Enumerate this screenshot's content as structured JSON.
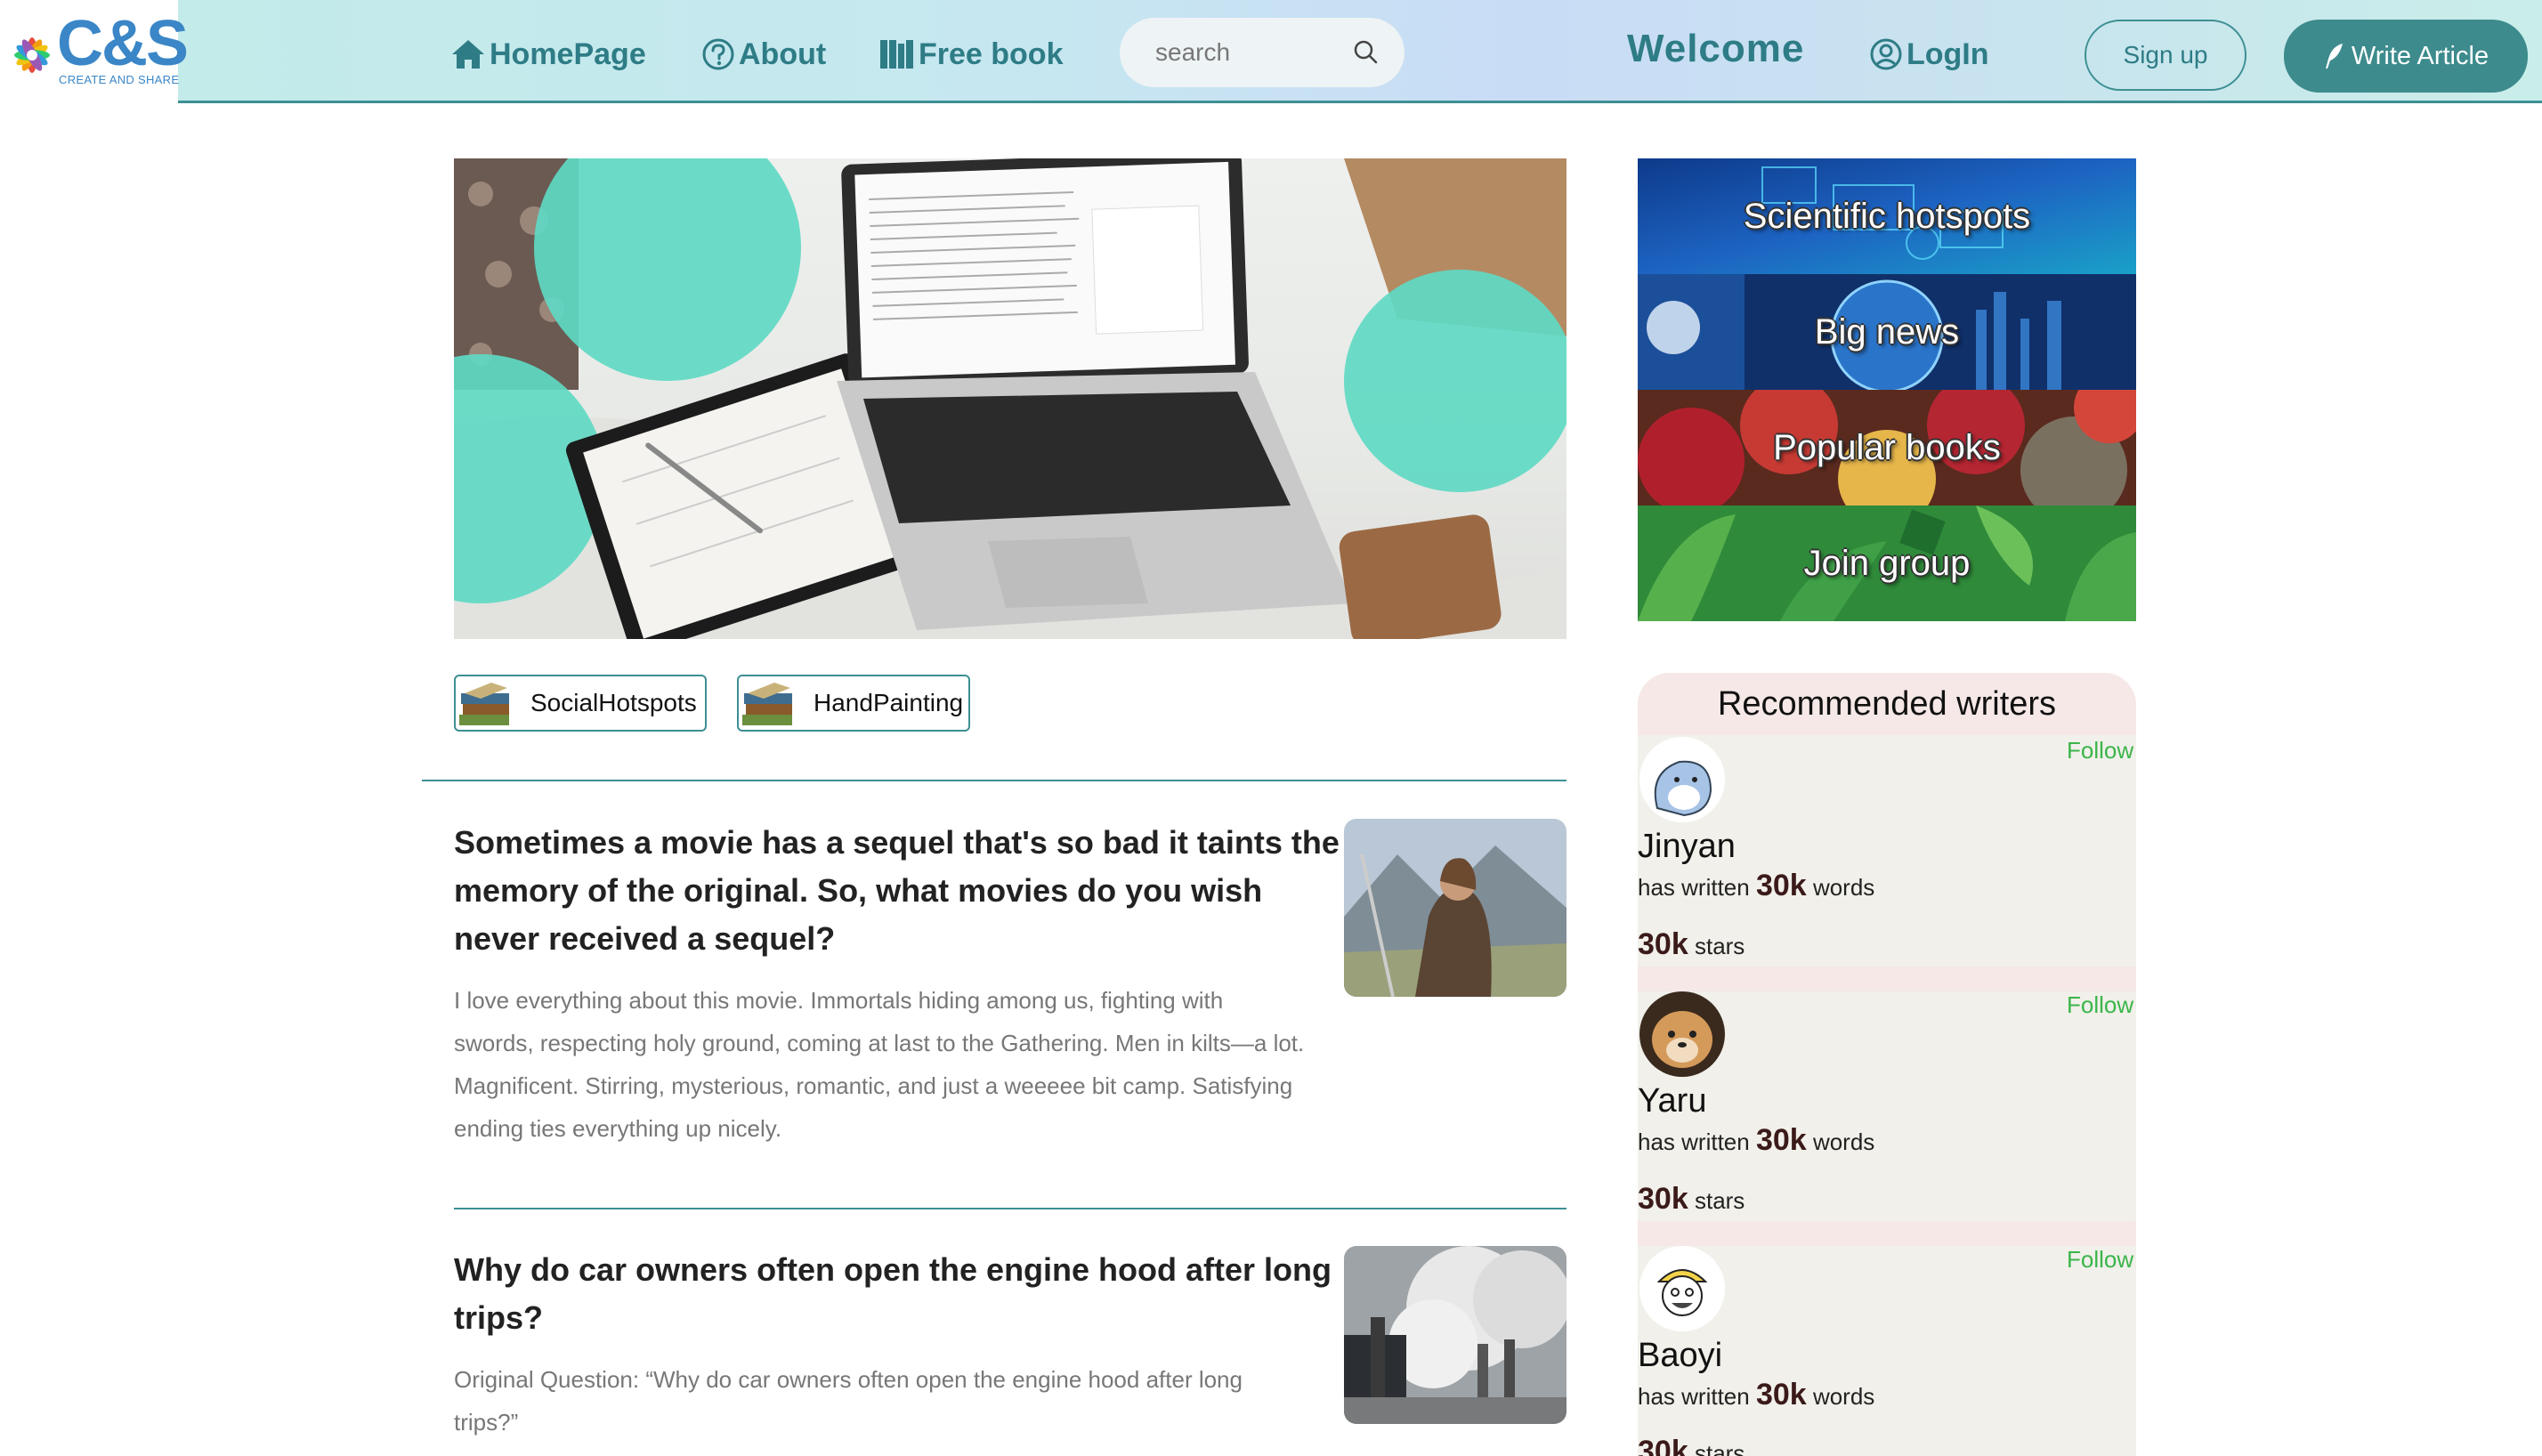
{
  "logo": {
    "text": "C&S",
    "subtitle": "CREATE AND SHARE"
  },
  "nav": {
    "home": "HomePage",
    "about": "About",
    "free_book": "Free book",
    "search_placeholder": "search",
    "welcome": "Welcome",
    "login": "LogIn",
    "signup": "Sign up",
    "write_article": "Write Article"
  },
  "tags": [
    "SocialHotspots",
    "HandPainting"
  ],
  "articles": [
    {
      "title": "Sometimes a movie has a sequel that's so bad it taints the memory of the original. So, what movies do you wish never received a sequel?",
      "body": "I love everything about this movie. Immortals hiding among us, fighting with swords, respecting holy ground, coming at last to the Gathering. Men in kilts—a lot. Magnificent. Stirring, mysterious, romantic, and just a weeeee bit camp. Satisfying ending ties everything up nicely."
    },
    {
      "title": "Why do car owners often open the engine hood after long trips?",
      "body": "Original Question: “Why do car owners often open the engine hood after long trips?”"
    }
  ],
  "banners": [
    "Scientific hotspots",
    "Big news",
    "Popular books",
    "Join group"
  ],
  "writers_panel": {
    "title": "Recommended writers",
    "follow_label": "Follow",
    "words_prefix": "has written",
    "words_suffix": "words",
    "stars_suffix": "stars",
    "writers": [
      {
        "name": "Jinyan",
        "words": "30k",
        "stars": "30k"
      },
      {
        "name": "Yaru",
        "words": "30k",
        "stars": "30k"
      },
      {
        "name": "Baoyi",
        "words": "30k",
        "stars": "30k"
      }
    ]
  },
  "colors": {
    "accent": "#3d8f93",
    "nav_text": "#2e7c86",
    "write_button": "#3d8b8d",
    "follow": "#3bb54a"
  }
}
